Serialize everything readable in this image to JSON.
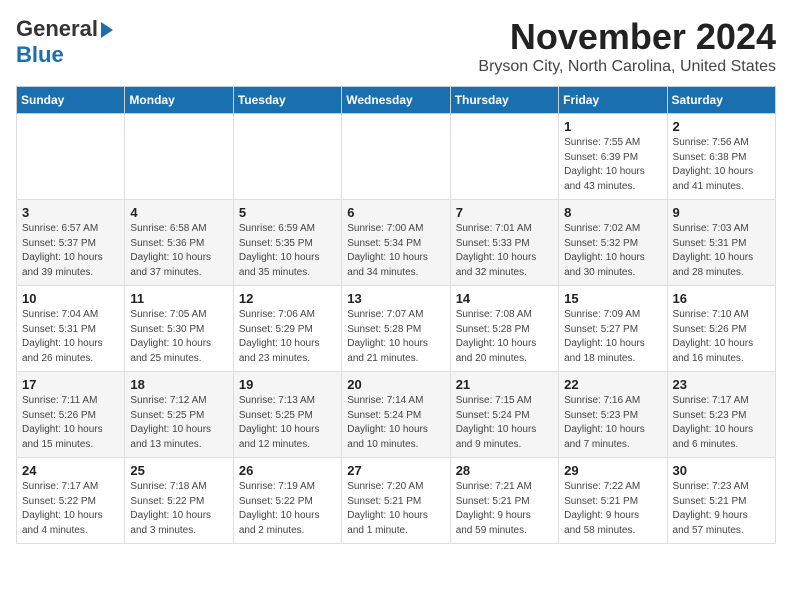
{
  "logo": {
    "line1": "General",
    "line2": "Blue"
  },
  "header": {
    "month": "November 2024",
    "location": "Bryson City, North Carolina, United States"
  },
  "weekdays": [
    "Sunday",
    "Monday",
    "Tuesday",
    "Wednesday",
    "Thursday",
    "Friday",
    "Saturday"
  ],
  "weeks": [
    [
      {
        "day": "",
        "info": ""
      },
      {
        "day": "",
        "info": ""
      },
      {
        "day": "",
        "info": ""
      },
      {
        "day": "",
        "info": ""
      },
      {
        "day": "",
        "info": ""
      },
      {
        "day": "1",
        "info": "Sunrise: 7:55 AM\nSunset: 6:39 PM\nDaylight: 10 hours\nand 43 minutes."
      },
      {
        "day": "2",
        "info": "Sunrise: 7:56 AM\nSunset: 6:38 PM\nDaylight: 10 hours\nand 41 minutes."
      }
    ],
    [
      {
        "day": "3",
        "info": "Sunrise: 6:57 AM\nSunset: 5:37 PM\nDaylight: 10 hours\nand 39 minutes."
      },
      {
        "day": "4",
        "info": "Sunrise: 6:58 AM\nSunset: 5:36 PM\nDaylight: 10 hours\nand 37 minutes."
      },
      {
        "day": "5",
        "info": "Sunrise: 6:59 AM\nSunset: 5:35 PM\nDaylight: 10 hours\nand 35 minutes."
      },
      {
        "day": "6",
        "info": "Sunrise: 7:00 AM\nSunset: 5:34 PM\nDaylight: 10 hours\nand 34 minutes."
      },
      {
        "day": "7",
        "info": "Sunrise: 7:01 AM\nSunset: 5:33 PM\nDaylight: 10 hours\nand 32 minutes."
      },
      {
        "day": "8",
        "info": "Sunrise: 7:02 AM\nSunset: 5:32 PM\nDaylight: 10 hours\nand 30 minutes."
      },
      {
        "day": "9",
        "info": "Sunrise: 7:03 AM\nSunset: 5:31 PM\nDaylight: 10 hours\nand 28 minutes."
      }
    ],
    [
      {
        "day": "10",
        "info": "Sunrise: 7:04 AM\nSunset: 5:31 PM\nDaylight: 10 hours\nand 26 minutes."
      },
      {
        "day": "11",
        "info": "Sunrise: 7:05 AM\nSunset: 5:30 PM\nDaylight: 10 hours\nand 25 minutes."
      },
      {
        "day": "12",
        "info": "Sunrise: 7:06 AM\nSunset: 5:29 PM\nDaylight: 10 hours\nand 23 minutes."
      },
      {
        "day": "13",
        "info": "Sunrise: 7:07 AM\nSunset: 5:28 PM\nDaylight: 10 hours\nand 21 minutes."
      },
      {
        "day": "14",
        "info": "Sunrise: 7:08 AM\nSunset: 5:28 PM\nDaylight: 10 hours\nand 20 minutes."
      },
      {
        "day": "15",
        "info": "Sunrise: 7:09 AM\nSunset: 5:27 PM\nDaylight: 10 hours\nand 18 minutes."
      },
      {
        "day": "16",
        "info": "Sunrise: 7:10 AM\nSunset: 5:26 PM\nDaylight: 10 hours\nand 16 minutes."
      }
    ],
    [
      {
        "day": "17",
        "info": "Sunrise: 7:11 AM\nSunset: 5:26 PM\nDaylight: 10 hours\nand 15 minutes."
      },
      {
        "day": "18",
        "info": "Sunrise: 7:12 AM\nSunset: 5:25 PM\nDaylight: 10 hours\nand 13 minutes."
      },
      {
        "day": "19",
        "info": "Sunrise: 7:13 AM\nSunset: 5:25 PM\nDaylight: 10 hours\nand 12 minutes."
      },
      {
        "day": "20",
        "info": "Sunrise: 7:14 AM\nSunset: 5:24 PM\nDaylight: 10 hours\nand 10 minutes."
      },
      {
        "day": "21",
        "info": "Sunrise: 7:15 AM\nSunset: 5:24 PM\nDaylight: 10 hours\nand 9 minutes."
      },
      {
        "day": "22",
        "info": "Sunrise: 7:16 AM\nSunset: 5:23 PM\nDaylight: 10 hours\nand 7 minutes."
      },
      {
        "day": "23",
        "info": "Sunrise: 7:17 AM\nSunset: 5:23 PM\nDaylight: 10 hours\nand 6 minutes."
      }
    ],
    [
      {
        "day": "24",
        "info": "Sunrise: 7:17 AM\nSunset: 5:22 PM\nDaylight: 10 hours\nand 4 minutes."
      },
      {
        "day": "25",
        "info": "Sunrise: 7:18 AM\nSunset: 5:22 PM\nDaylight: 10 hours\nand 3 minutes."
      },
      {
        "day": "26",
        "info": "Sunrise: 7:19 AM\nSunset: 5:22 PM\nDaylight: 10 hours\nand 2 minutes."
      },
      {
        "day": "27",
        "info": "Sunrise: 7:20 AM\nSunset: 5:21 PM\nDaylight: 10 hours\nand 1 minute."
      },
      {
        "day": "28",
        "info": "Sunrise: 7:21 AM\nSunset: 5:21 PM\nDaylight: 9 hours\nand 59 minutes."
      },
      {
        "day": "29",
        "info": "Sunrise: 7:22 AM\nSunset: 5:21 PM\nDaylight: 9 hours\nand 58 minutes."
      },
      {
        "day": "30",
        "info": "Sunrise: 7:23 AM\nSunset: 5:21 PM\nDaylight: 9 hours\nand 57 minutes."
      }
    ]
  ]
}
